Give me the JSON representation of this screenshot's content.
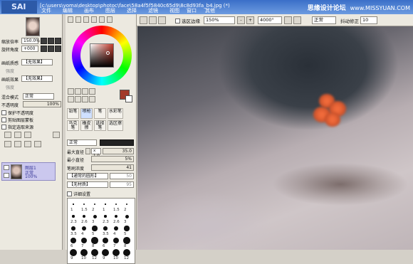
{
  "window": {
    "app_logo": "SAI",
    "title": "[c:\\users\\yoma\\desktop\\photoc\\face\\58a4f5f5840c65d9\\8c8d93fa_b4.jpg (*)",
    "watermark": "思缘设计论坛",
    "watermark_url": "www.MISSYUAN.COM"
  },
  "menu": [
    "文件",
    "编辑",
    "画布",
    "图层",
    "选择",
    "滤镜",
    "视图",
    "窗口",
    "其他"
  ],
  "toolbar": {
    "selection_edge_label": "选区边缘",
    "zoom": "150%",
    "rotation": "4000°",
    "mode": "正常",
    "stabilizer_label": "抖动修正",
    "stabilizer_value": "10"
  },
  "navigator": {
    "zoom_label": "缩放倍率",
    "zoom_value": "150.0%",
    "angle_label": "旋转角度",
    "angle_value": "+000"
  },
  "layer_panel": {
    "paper_texture_label": "画纸质感",
    "paper_texture_value": "【无效果】",
    "paper_effect_label": "画纸效果",
    "paper_effect_value": "【无效果】",
    "strength_label": "强度",
    "blend_label": "混合模式",
    "blend_value": "正常",
    "opacity_label": "不透明度",
    "opacity_value": "100%",
    "protect_label": "保护不透明度",
    "clip_label": "剪贴图层蒙板",
    "source_label": "指定选取来源",
    "layer_name": "图层1",
    "layer_mode": "正常",
    "layer_opacity": "100%"
  },
  "tools": {
    "row1": [
      "铅笔",
      "喷枪",
      "笔",
      "水彩笔"
    ],
    "row2": [
      "马克笔",
      "橡皮擦",
      "选择笔",
      "选区擦"
    ]
  },
  "brush": {
    "mode": "正常",
    "max_size_label": "最大直径",
    "max_size_mult": "x 1.0",
    "max_size_value": "35.0",
    "min_size_label": "最小直径",
    "min_size_value": "5%",
    "density_label": "笔刷浓度",
    "density_value": "41",
    "shape_label": "【通常的圆形】",
    "shape_value": "50",
    "texture_label": "【无材质】",
    "texture_value": "95",
    "detail_label": "详细设置",
    "size_rows": [
      [
        "1",
        "1.5",
        "2"
      ],
      [
        "2.3",
        "2.6",
        "3"
      ],
      [
        "3.5",
        "4",
        "5"
      ],
      [
        "6",
        "7",
        "8"
      ],
      [
        "9",
        "10",
        "12"
      ]
    ]
  },
  "colors": {
    "accent_swatch": "#a23a2a",
    "selected_layer": "#cbc8ee",
    "titlebar": "#3a6fc8"
  }
}
